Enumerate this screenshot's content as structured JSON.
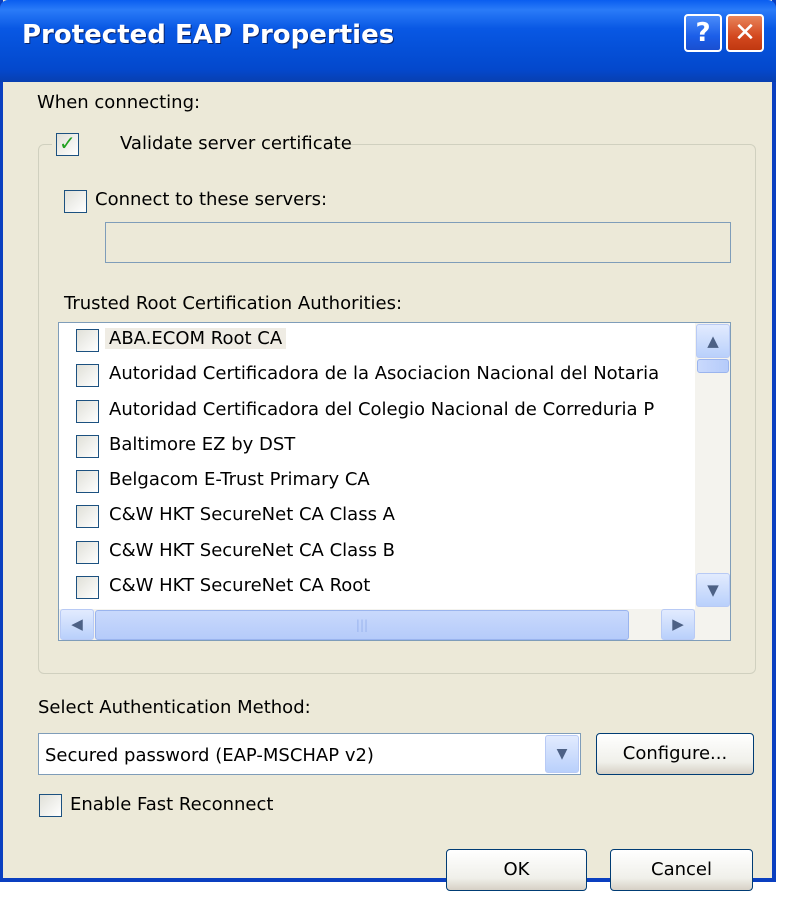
{
  "window": {
    "title": "Protected EAP Properties",
    "help_glyph": "?",
    "close_glyph": "✕"
  },
  "when_connecting_label": "When connecting:",
  "validate_cert": {
    "label": "Validate server certificate",
    "checked": true
  },
  "connect_servers": {
    "label": "Connect to these servers:",
    "checked": false,
    "value": ""
  },
  "trusted_root_label": "Trusted Root Certification Authorities:",
  "ca_list": [
    {
      "label": "ABA.ECOM Root CA",
      "checked": false
    },
    {
      "label": "Autoridad Certificadora de la Asociacion Nacional del Notaria",
      "checked": false
    },
    {
      "label": "Autoridad Certificadora del Colegio Nacional de Correduria P",
      "checked": false
    },
    {
      "label": "Baltimore EZ by DST",
      "checked": false
    },
    {
      "label": "Belgacom E-Trust Primary CA",
      "checked": false
    },
    {
      "label": "C&W HKT SecureNet CA Class A",
      "checked": false
    },
    {
      "label": "C&W HKT SecureNet CA Class B",
      "checked": false
    },
    {
      "label": "C&W HKT SecureNet CA Root",
      "checked": false
    }
  ],
  "scrollbar": {
    "up_icon": "up-arrow-icon",
    "up_glyph": "▲",
    "down_icon": "down-arrow-icon",
    "down_glyph": "▼",
    "left_glyph": "◀",
    "right_glyph": "▶",
    "grip_glyph": "|||"
  },
  "auth_method": {
    "label": "Select Authentication Method:",
    "selected": "Secured password (EAP-MSCHAP v2)",
    "arrow_glyph": "▼",
    "configure_label": "Configure..."
  },
  "fast_reconnect": {
    "label": "Enable Fast Reconnect",
    "checked": false
  },
  "buttons": {
    "ok": "OK",
    "cancel": "Cancel"
  },
  "colors": {
    "titlebar": "#0a5ef0",
    "dialog_bg": "#ece9d8",
    "check_green": "#21a121",
    "close_red": "#d3481f"
  }
}
